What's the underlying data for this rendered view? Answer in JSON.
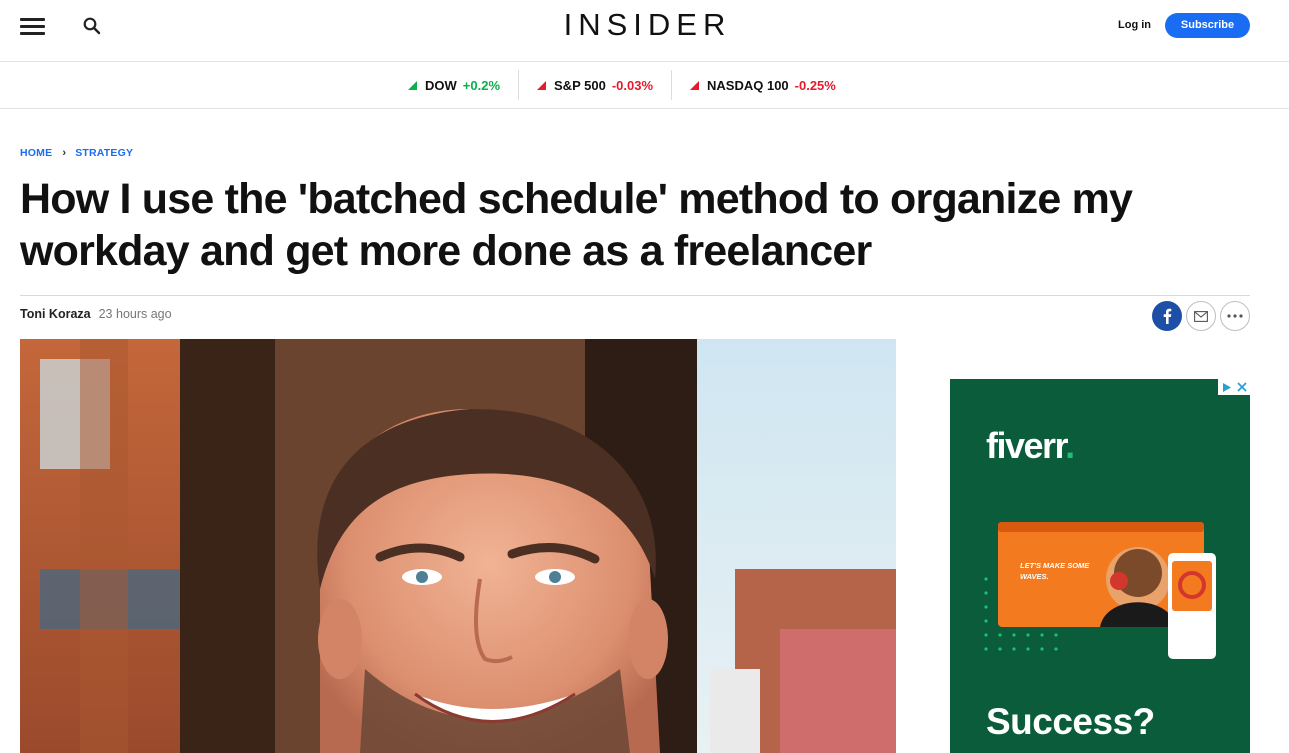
{
  "header": {
    "logo": "INSIDER",
    "login_label": "Log in",
    "subscribe_label": "Subscribe"
  },
  "ticker": [
    {
      "name": "DOW",
      "change": "+0.2%",
      "direction": "up"
    },
    {
      "name": "S&P 500",
      "change": "-0.03%",
      "direction": "down"
    },
    {
      "name": "NASDAQ 100",
      "change": "-0.25%",
      "direction": "down"
    }
  ],
  "breadcrumb": {
    "home": "HOME",
    "section": "STRATEGY"
  },
  "article": {
    "headline": "How I use the 'batched schedule' method to organize my workday and get more done as a freelancer",
    "author": "Toni Koraza",
    "timestamp": "23 hours ago"
  },
  "ad": {
    "brand": "fiverr",
    "brand_dot": ".",
    "mock_headline": "LET'S MAKE SOME WAVES.",
    "headline": "Success?"
  },
  "icons": {
    "menu": "hamburger-menu-icon",
    "search": "search-icon",
    "facebook": "facebook-icon",
    "email": "email-icon",
    "more": "more-options-icon",
    "adchoices": "adchoices-icon",
    "ad_close": "close-icon"
  },
  "colors": {
    "accent": "#1a6cf3",
    "up": "#0ab14a",
    "down": "#e41b2c",
    "facebook": "#1d4fa6",
    "ad_background": "#0a5c3a",
    "ad_brand_dot": "#1dbf73"
  }
}
